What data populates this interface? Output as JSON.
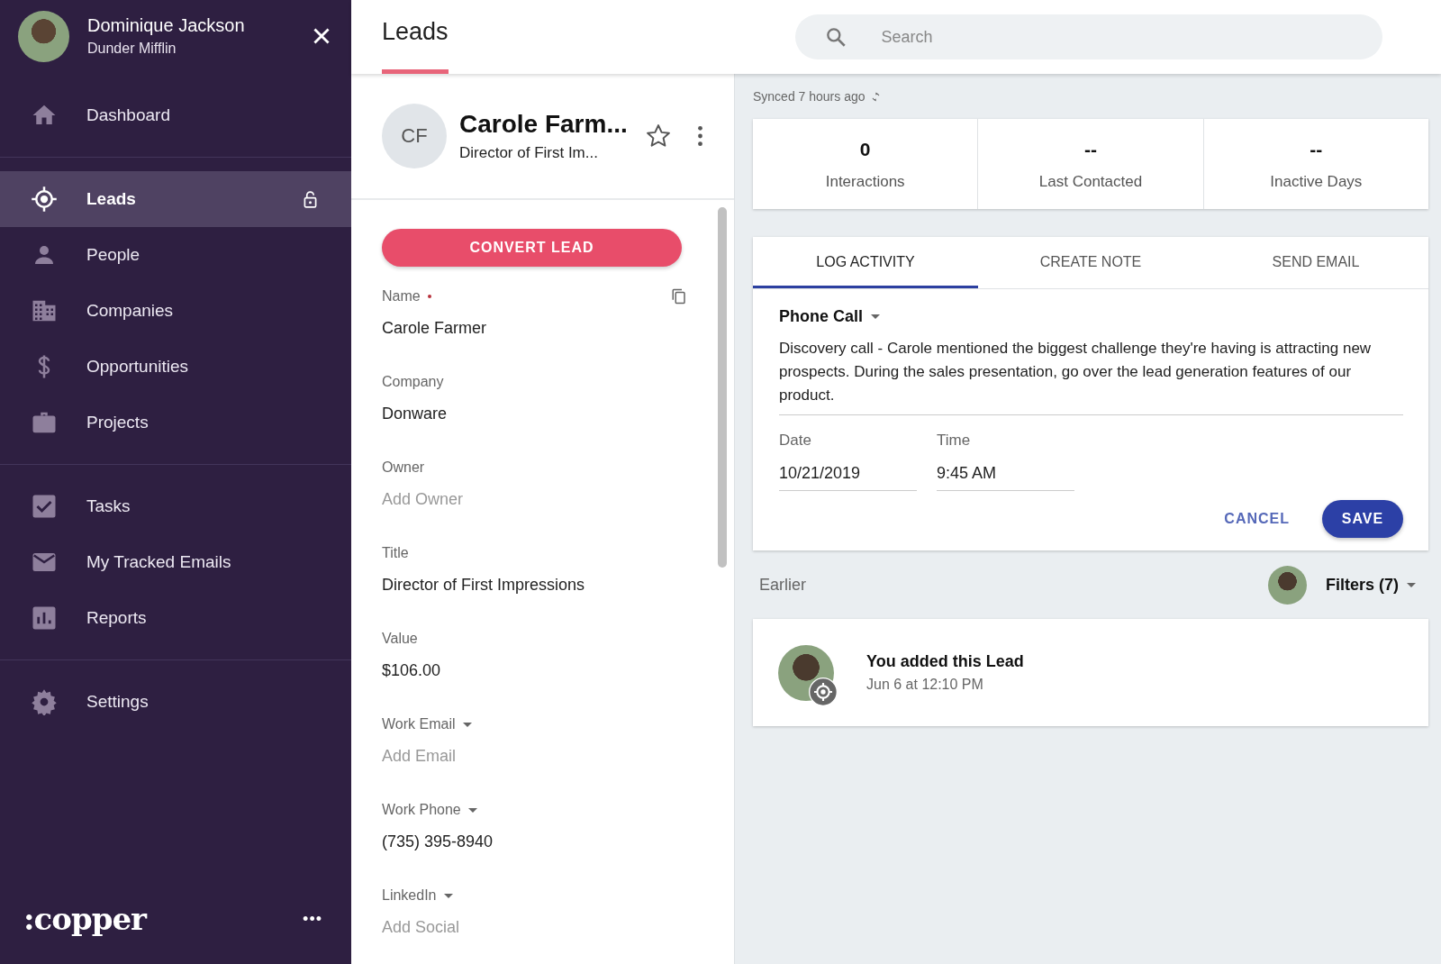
{
  "user": {
    "name": "Dominique Jackson",
    "company": "Dunder Mifflin"
  },
  "sidebar": {
    "groups": [
      [
        {
          "label": "Dashboard",
          "selected": false,
          "locked": false
        }
      ],
      [
        {
          "label": "Leads",
          "selected": true,
          "locked": true
        },
        {
          "label": "People",
          "selected": false,
          "locked": false
        },
        {
          "label": "Companies",
          "selected": false,
          "locked": false
        },
        {
          "label": "Opportunities",
          "selected": false,
          "locked": false
        },
        {
          "label": "Projects",
          "selected": false,
          "locked": false
        }
      ],
      [
        {
          "label": "Tasks",
          "selected": false,
          "locked": false
        },
        {
          "label": "My Tracked Emails",
          "selected": false,
          "locked": false
        },
        {
          "label": "Reports",
          "selected": false,
          "locked": false
        }
      ],
      [
        {
          "label": "Settings",
          "selected": false,
          "locked": false
        }
      ]
    ],
    "logo": ":copper",
    "more": "•••"
  },
  "page_title": "Leads",
  "search": {
    "placeholder": "Search"
  },
  "lead": {
    "initials": "CF",
    "name": "Carole Farm...",
    "subtitle": "Director of First Im...",
    "starred": false,
    "convert_button": "CONVERT LEAD",
    "fields": [
      {
        "label": "Name",
        "value": "Carole Farmer",
        "required": true,
        "dropdown": false,
        "copyable": true
      },
      {
        "label": "Company",
        "value": "Donware",
        "required": false,
        "dropdown": false,
        "copyable": false
      },
      {
        "label": "Owner",
        "placeholder": "Add Owner",
        "required": false,
        "dropdown": false,
        "copyable": false
      },
      {
        "label": "Title",
        "value": "Director of First Impressions",
        "required": false,
        "dropdown": false,
        "copyable": false
      },
      {
        "label": "Value",
        "value": "$106.00",
        "required": false,
        "dropdown": false,
        "copyable": false
      },
      {
        "label": "Work Email",
        "placeholder": "Add Email",
        "required": false,
        "dropdown": true,
        "copyable": false
      },
      {
        "label": "Work Phone",
        "value": "(735) 395-8940",
        "required": false,
        "dropdown": true,
        "copyable": false
      },
      {
        "label": "LinkedIn",
        "placeholder": "Add Social",
        "required": false,
        "dropdown": true,
        "copyable": false
      }
    ]
  },
  "sync_status": "Synced 7 hours ago",
  "stats": [
    {
      "value": "0",
      "label": "Interactions"
    },
    {
      "value": "--",
      "label": "Last Contacted"
    },
    {
      "value": "--",
      "label": "Inactive Days"
    }
  ],
  "activity_tabs": [
    {
      "label": "LOG ACTIVITY",
      "selected": true
    },
    {
      "label": "CREATE NOTE",
      "selected": false
    },
    {
      "label": "SEND EMAIL",
      "selected": false
    }
  ],
  "activity_form": {
    "type": "Phone Call",
    "description": "Discovery call - Carole mentioned the biggest challenge they're having is attracting new prospects. During the sales presentation, go over the lead generation features of our product.",
    "date": {
      "label": "Date",
      "value": "10/21/2019"
    },
    "time": {
      "label": "Time",
      "value": "9:45 AM"
    },
    "cancel": "CANCEL",
    "save": "SAVE"
  },
  "feed": {
    "heading": "Earlier",
    "filters": "Filters (7)",
    "items": [
      {
        "title": "You added this Lead",
        "time": "Jun 6 at 12:10 PM"
      }
    ]
  }
}
